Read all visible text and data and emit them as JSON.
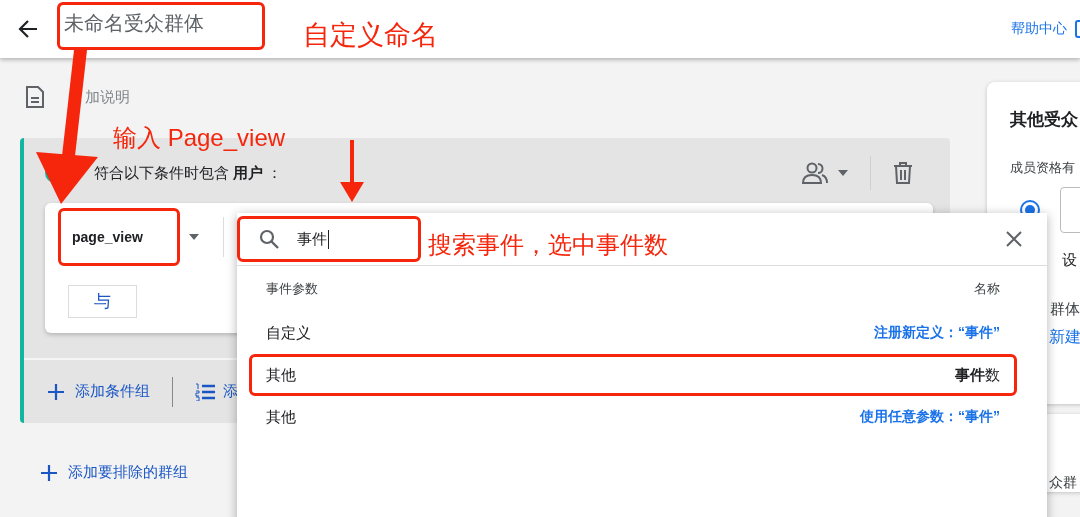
{
  "top_bar": {
    "title": "未命名受众群体",
    "title_annotated": true,
    "help_link": "帮助中心"
  },
  "description_link": "加说明",
  "condition_group": {
    "prefix": "符合以下条件时包含 **用户** ：",
    "event_dropdown": {
      "value": "page_view",
      "annotated": true
    },
    "and_button": "与",
    "add_group": "添加条件组",
    "add_sequence": "添"
  },
  "exclude_link": "添加要排除的群组",
  "side_panel": {
    "title": "其他受众",
    "membership_label": "成员资格有",
    "radio_selected": true,
    "line_1": "设",
    "line_2": "群体",
    "create_link": "新建",
    "line_3": "众群"
  },
  "picker": {
    "search": {
      "value": "事件",
      "annotated": true
    },
    "header": {
      "left": "事件参数",
      "right": "名称"
    },
    "rows": [
      {
        "kind": "action",
        "category": "自定义",
        "text": "注册新定义：“事件”",
        "annotated": false
      },
      {
        "kind": "match",
        "category": "其他",
        "text": "**事件**数",
        "annotated": true
      },
      {
        "kind": "action",
        "category": "其他",
        "text": "使用任意参数：“事件”",
        "annotated": false
      }
    ]
  },
  "annotations": {
    "name_note": "自定义命名",
    "input_note": "输入 Page_view",
    "search_note": "搜索事件，选中事件数"
  }
}
